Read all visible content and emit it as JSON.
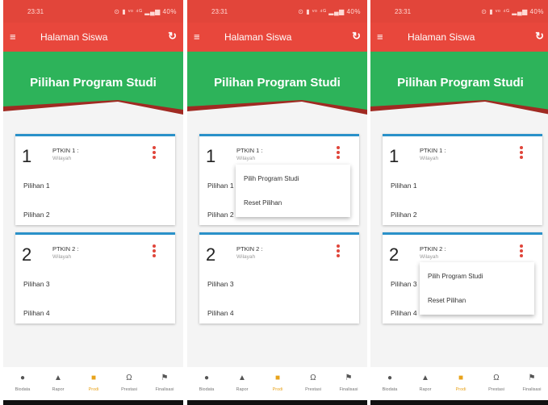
{
  "status_bar": {
    "time": "23:31",
    "icons": "⊙ ▮ ᵛᵒ ⁴ᴳ ▂▄▆ 40%"
  },
  "app_bar": {
    "title": "Halaman Siswa",
    "menu_icon": "hamburger-menu-icon",
    "refresh_icon": "refresh-icon"
  },
  "banner": {
    "heading": "Pilihan Program Studi"
  },
  "cards": [
    {
      "number": "1",
      "label": "PTKIN 1 :",
      "sub": "Wilayah",
      "options": [
        "Pilihan 1",
        "Pilihan 2"
      ]
    },
    {
      "number": "2",
      "label": "PTKIN 2 :",
      "sub": "Wilayah",
      "options": [
        "Pilihan 3",
        "Pilihan 4"
      ]
    }
  ],
  "popup_menu": {
    "items": [
      "Pilih Program Studi",
      "Reset Pilihan"
    ]
  },
  "bottom_nav": {
    "items": [
      {
        "label": "Biodata",
        "icon": "person-icon"
      },
      {
        "label": "Rapor",
        "icon": "graduation-cap-icon"
      },
      {
        "label": "Prodi",
        "icon": "folder-icon",
        "active": true
      },
      {
        "label": "Prestasi",
        "icon": "trophy-icon"
      },
      {
        "label": "Finalisasi",
        "icon": "flag-icon"
      }
    ]
  },
  "colors": {
    "primary_red": "#e8473c",
    "banner_green": "#2db35a",
    "card_accent": "#2a91c9",
    "active_nav": "#e8a31c",
    "kebab": "#e0463b"
  }
}
